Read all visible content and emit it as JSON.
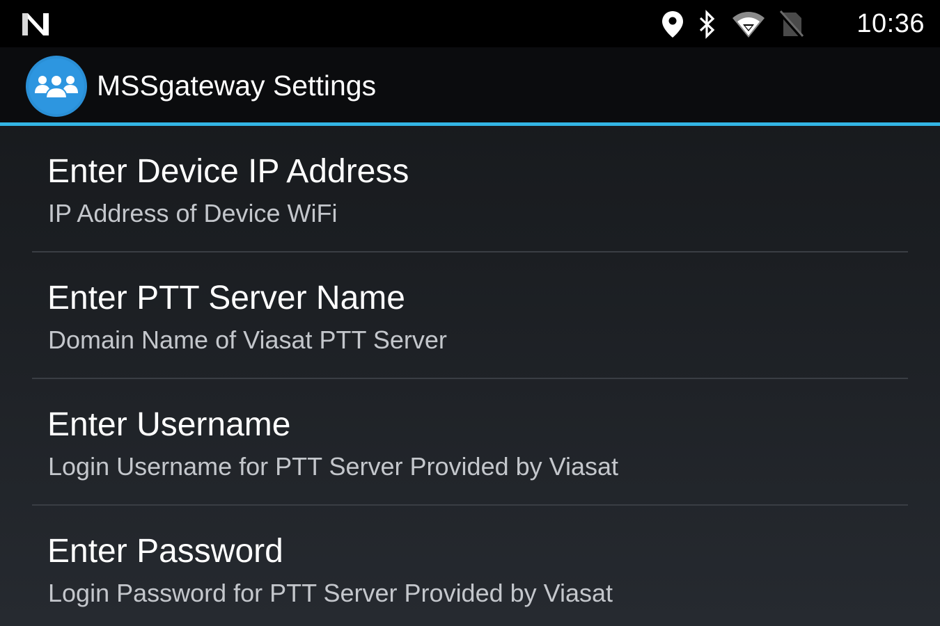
{
  "status_bar": {
    "notification_icon": "n-logo-icon",
    "icons": [
      "location-pin-icon",
      "bluetooth-icon",
      "wifi-icon",
      "no-sim-icon"
    ],
    "time": "10:36"
  },
  "action_bar": {
    "app_icon": "group-users-icon",
    "title": "MSSgateway Settings",
    "accent_color": "#33b5e5"
  },
  "preferences": [
    {
      "title": "Enter Device IP Address",
      "summary": "IP Address of Device WiFi"
    },
    {
      "title": "Enter PTT Server Name",
      "summary": "Domain Name of Viasat PTT Server"
    },
    {
      "title": "Enter Username",
      "summary": "Login Username for PTT Server Provided by Viasat"
    },
    {
      "title": "Enter Password",
      "summary": "Login Password for PTT Server Provided by Viasat"
    }
  ]
}
